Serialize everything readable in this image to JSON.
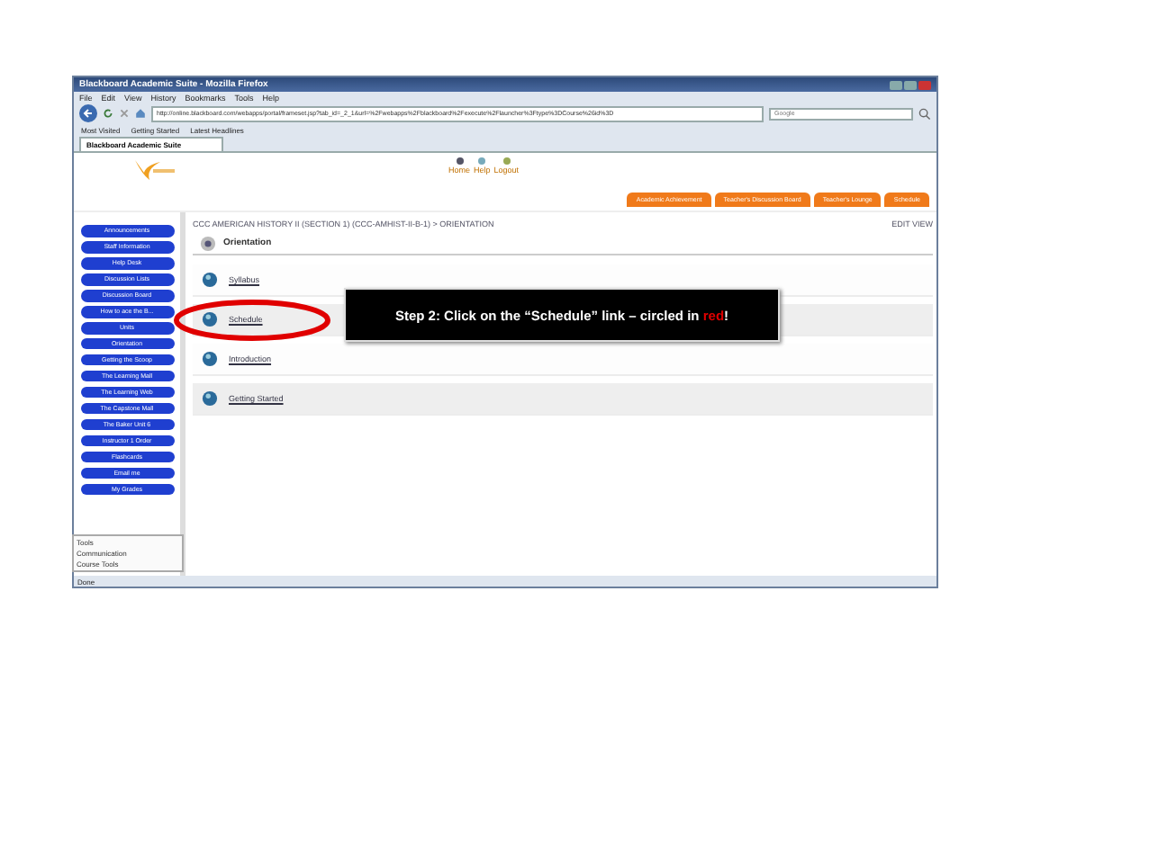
{
  "window": {
    "title": "Blackboard Academic Suite - Mozilla Firefox"
  },
  "menu": [
    "File",
    "Edit",
    "View",
    "History",
    "Bookmarks",
    "Tools",
    "Help"
  ],
  "address": {
    "value": "http://online.blackboard.com/webapps/portal/frameset.jsp?tab_id=_2_1&url=%2Fwebapps%2Fblackboard%2Fexecute%2Flauncher%3Ftype%3DCourse%26id%3D"
  },
  "search": {
    "placeholder": "Google"
  },
  "bookmarks": [
    "Most Visited",
    "Getting Started",
    "Latest Headlines"
  ],
  "browser_tabs": [
    {
      "label": "Blackboard Academic Suite",
      "selected": true
    }
  ],
  "header_links": [
    "Home",
    "Help",
    "Logout"
  ],
  "portal_tabs": [
    {
      "label": "Academic Achievement",
      "selected": false
    },
    {
      "label": "Teacher's Discussion Board",
      "selected": false
    },
    {
      "label": "Teacher's Lounge",
      "selected": false
    },
    {
      "label": "Schedule",
      "selected": false
    }
  ],
  "course_menu": [
    "Announcements",
    "Staff Information",
    "Help Desk",
    "Discussion Lists",
    "Discussion Board",
    "How to ace the B...",
    "Units",
    "Orientation",
    "Getting the Scoop",
    "The Learning Mall",
    "The Learning Web",
    "The Capstone Mall",
    "The Baker Unit 6",
    "Instructor 1 Order",
    "Flashcards",
    "Email me",
    "My Grades"
  ],
  "breadcrumb": "CCC AMERICAN HISTORY II (SECTION 1) (CCC-AMHIST-II-B-1) > ORIENTATION",
  "edit_view": "EDIT VIEW",
  "page_title": "Orientation",
  "items": [
    {
      "label": "Syllabus",
      "shaded": false,
      "circled": false
    },
    {
      "label": "Schedule",
      "shaded": true,
      "circled": true
    },
    {
      "label": "Introduction",
      "shaded": false,
      "circled": false
    },
    {
      "label": "Getting Started",
      "shaded": true,
      "circled": false
    }
  ],
  "tools": {
    "title": "Tools",
    "entries": [
      "Communication",
      "Course Tools"
    ]
  },
  "status_bar": "Done",
  "callout": {
    "text": "Step 2: Click on the “Schedule” link – circled in **red**!"
  }
}
